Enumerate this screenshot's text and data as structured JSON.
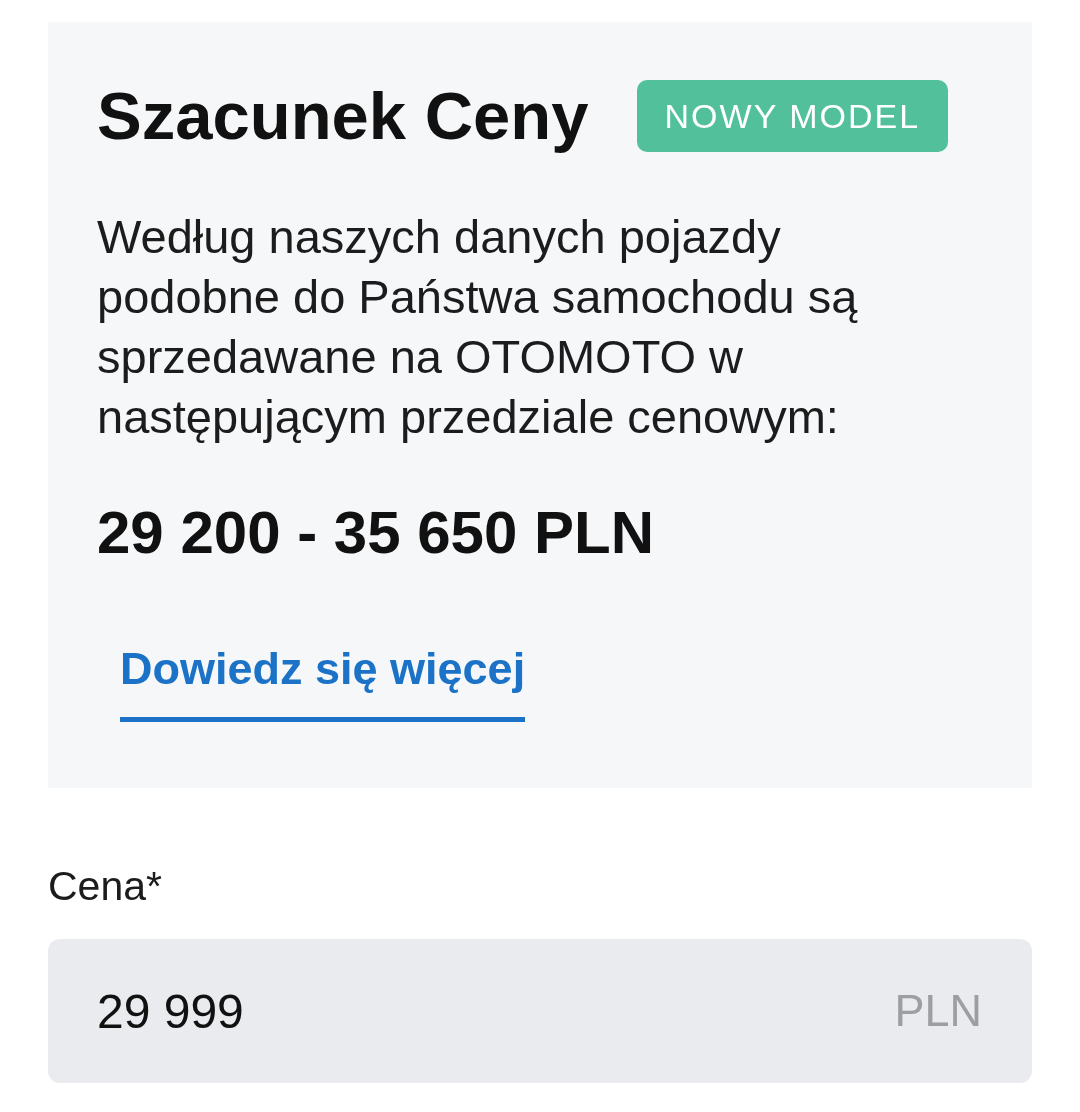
{
  "price_estimate": {
    "title": "Szacunek Ceny",
    "badge": "NOWY MODEL",
    "description": "Według naszych danych pojazdy podobne do Państwa samochodu są sprzedawane na OTOMOTO w następującym przedziale cenowym:",
    "price_range": "29 200 - 35 650 PLN",
    "link": "Dowiedz się więcej"
  },
  "price_field": {
    "label": "Cena*",
    "value": "29 999",
    "unit": "PLN"
  }
}
